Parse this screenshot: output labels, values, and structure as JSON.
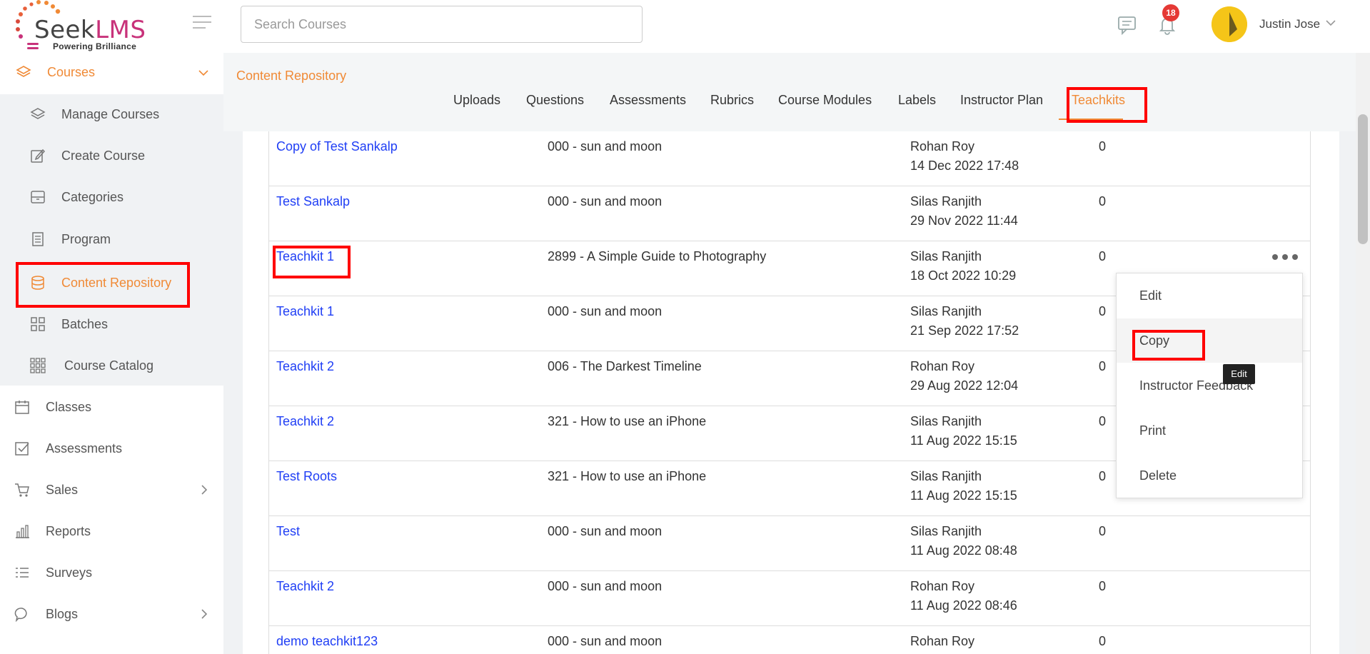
{
  "app": {
    "brand": "SeekLMS",
    "brand_seek": "Seek",
    "brand_lms": "LMS",
    "tagline": "Powering Brilliance",
    "accent": "#f08a36",
    "link_color": "#1f3ef5"
  },
  "header": {
    "search_placeholder": "Search Courses",
    "notifications_count": "18",
    "user_name": "Justin Jose"
  },
  "sidebar": {
    "courses_label": "Courses",
    "sub_items": [
      {
        "label": "Manage Courses",
        "icon": "layers-icon"
      },
      {
        "label": "Create Course",
        "icon": "edit-icon"
      },
      {
        "label": "Categories",
        "icon": "archive-icon"
      },
      {
        "label": "Program",
        "icon": "document-icon"
      },
      {
        "label": "Content Repository",
        "icon": "database-icon"
      },
      {
        "label": "Batches",
        "icon": "grid-icon"
      },
      {
        "label": "Course Catalog",
        "icon": "apps-icon"
      }
    ],
    "items": [
      {
        "label": "Classes",
        "icon": "calendar-icon"
      },
      {
        "label": "Assessments",
        "icon": "checkbox-icon"
      },
      {
        "label": "Sales",
        "icon": "cart-icon"
      },
      {
        "label": "Reports",
        "icon": "bar-chart-icon"
      },
      {
        "label": "Surveys",
        "icon": "list-icon"
      },
      {
        "label": "Blogs",
        "icon": "chat-icon"
      }
    ]
  },
  "breadcrumb": "Content Repository",
  "tabs": [
    "Uploads",
    "Questions",
    "Assessments",
    "Rubrics",
    "Course Modules",
    "Labels",
    "Instructor Plan",
    "Teachkits"
  ],
  "rows": [
    {
      "name": "Copy of Test Sankalp",
      "course": "000 - sun and moon",
      "author": "Rohan Roy",
      "date": "14 Dec 2022 17:48",
      "count": "0"
    },
    {
      "name": "Test Sankalp",
      "course": "000 - sun and moon",
      "author": "Silas Ranjith",
      "date": "29 Nov 2022 11:44",
      "count": "0"
    },
    {
      "name": "Teachkit 1",
      "course": "2899 - A Simple Guide to Photography",
      "author": "Silas Ranjith",
      "date": "18 Oct 2022 10:29",
      "count": "0"
    },
    {
      "name": "Teachkit 1",
      "course": "000 - sun and moon",
      "author": "Silas Ranjith",
      "date": "21 Sep 2022 17:52",
      "count": "0"
    },
    {
      "name": "Teachkit 2",
      "course": "006 - The Darkest Timeline",
      "author": "Rohan Roy",
      "date": "29 Aug 2022 12:04",
      "count": "0"
    },
    {
      "name": "Teachkit 2",
      "course": "321 - How to use an iPhone",
      "author": "Silas Ranjith",
      "date": "11 Aug 2022 15:15",
      "count": "0"
    },
    {
      "name": "Test Roots",
      "course": "321 - How to use an iPhone",
      "author": "Silas Ranjith",
      "date": "11 Aug 2022 15:15",
      "count": "0"
    },
    {
      "name": "Test",
      "course": "000 - sun and moon",
      "author": "Silas Ranjith",
      "date": "11 Aug 2022 08:48",
      "count": "0"
    },
    {
      "name": "Teachkit 2",
      "course": "000 - sun and moon",
      "author": "Rohan Roy",
      "date": "11 Aug 2022 08:46",
      "count": "0"
    },
    {
      "name": "demo teachkit123",
      "course": "000 - sun and moon",
      "author": "Rohan Roy",
      "date": "",
      "count": "0"
    }
  ],
  "context_menu": [
    "Edit",
    "Copy",
    "Instructor Feedback",
    "Print",
    "Delete"
  ],
  "tooltip": "Edit"
}
